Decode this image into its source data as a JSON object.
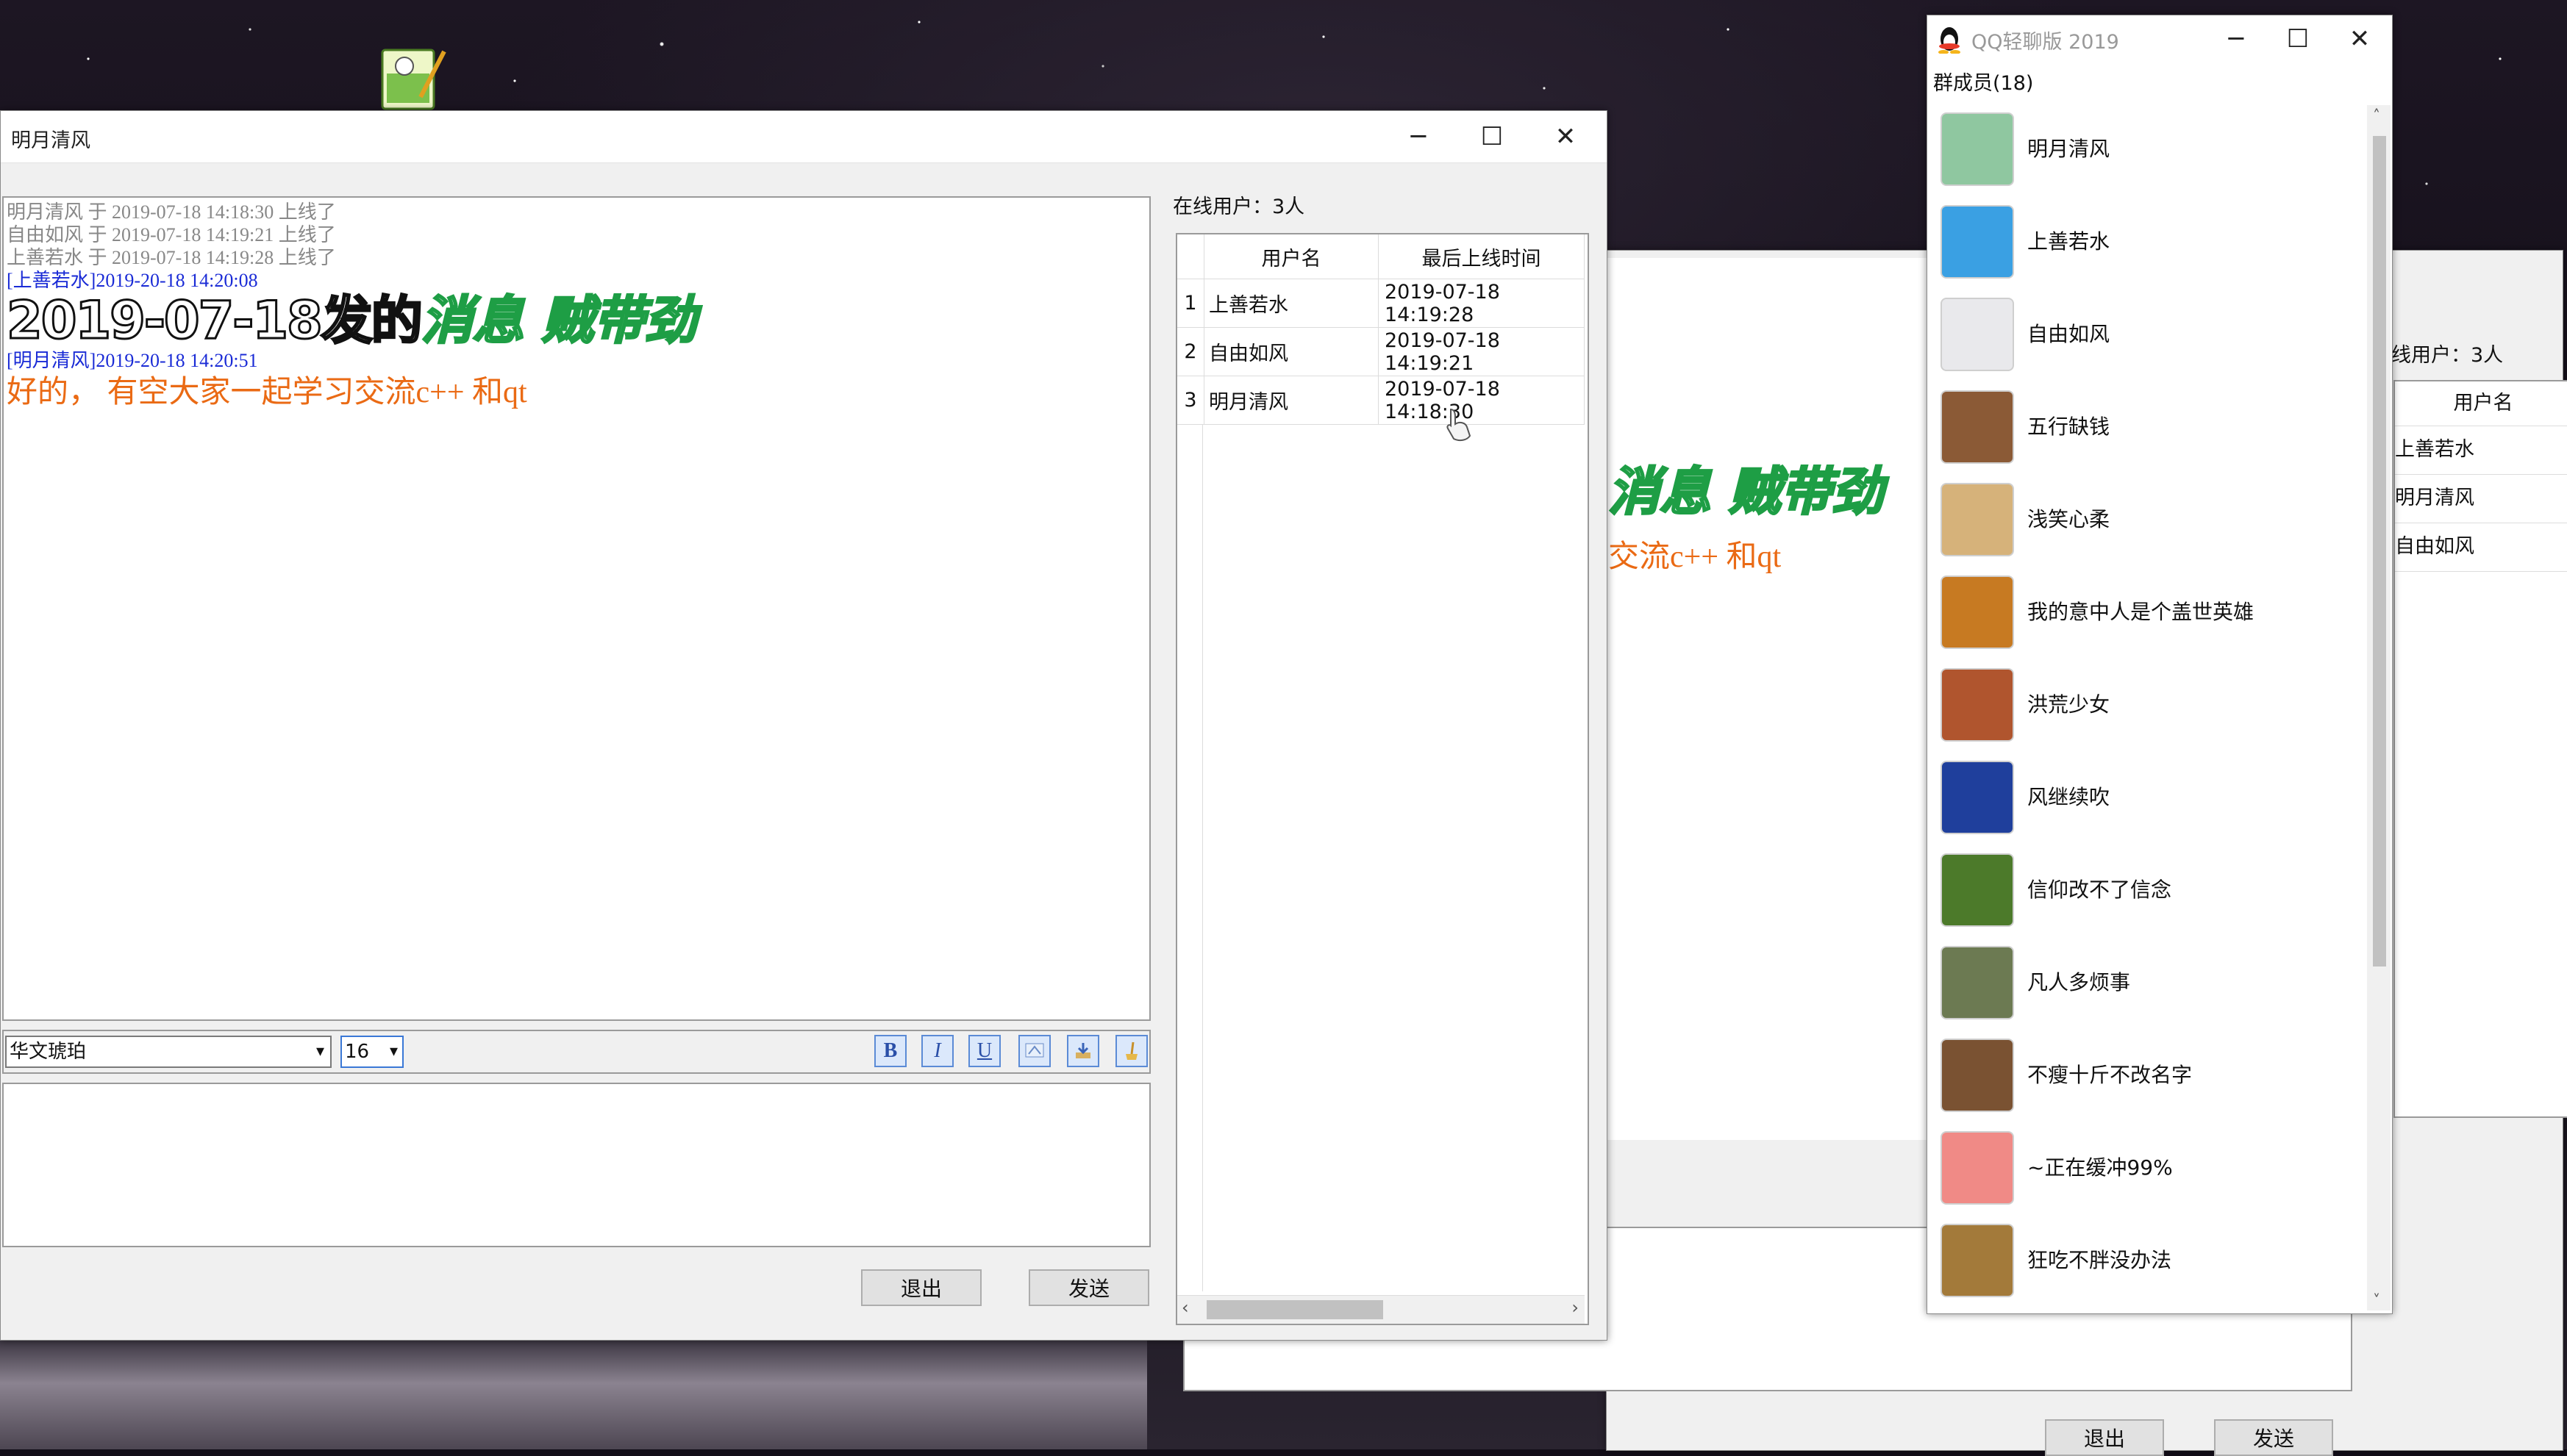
{
  "chat_window": {
    "title": "明月清风",
    "log": {
      "system_lines": [
        "明月清风 于 2019-07-18 14:18:30 上线了",
        "自由如风 于 2019-07-18 14:19:21 上线了",
        "上善若水 于 2019-07-18 14:19:28 上线了"
      ],
      "msg1_meta": "[上善若水]2019-20-18 14:20:08",
      "msg1_text_a": "2019-07-18发的",
      "msg1_text_b": "消息  贼带劲",
      "msg2_meta": "[明月清风]2019-20-18 14:20:51",
      "msg2_text": "好的， 有空大家一起学习交流c++  和qt"
    },
    "font_combo": "华文琥珀",
    "size_combo": "16",
    "format_buttons": {
      "bold": "B",
      "italic": "I",
      "underline": "U"
    },
    "quit_button": "退出",
    "send_button": "发送",
    "online_label": "在线用户：3人",
    "online_table": {
      "headers": [
        "用户名",
        "最后上线时间"
      ],
      "rows": [
        {
          "index": "1",
          "name": "上善若水",
          "time": "2019-07-18 14:19:28"
        },
        {
          "index": "2",
          "name": "自由如风",
          "time": "2019-07-18 14:19:21"
        },
        {
          "index": "3",
          "name": "明月清风",
          "time": "2019-07-18 14:18:30"
        }
      ]
    }
  },
  "back_window": {
    "text_a": "消息  贼带劲",
    "text_b": "交流c++  和qt",
    "online_label": "在线用户：3人",
    "header": "用户名",
    "rows": [
      "上善若水",
      "明月清风",
      "自由如风"
    ],
    "quit_button": "退出",
    "send_button": "发送"
  },
  "members_window": {
    "title": "QQ轻聊版 2019",
    "group_label": "群成员(18)",
    "members": [
      {
        "name": "明月清风",
        "color": "#8fc7a0"
      },
      {
        "name": "上善若水",
        "color": "#3aa0e3"
      },
      {
        "name": "自由如风",
        "color": "#e9e9ec"
      },
      {
        "name": "五行缺钱",
        "color": "#8b5a36"
      },
      {
        "name": "浅笑心柔",
        "color": "#d6b27a"
      },
      {
        "name": "我的意中人是个盖世英雄",
        "color": "#c77a22"
      },
      {
        "name": "洪荒少女",
        "color": "#b0552e"
      },
      {
        "name": "风继续吹",
        "color": "#1f3f9c"
      },
      {
        "name": "信仰改不了信念",
        "color": "#4c7a2a"
      },
      {
        "name": "凡人多烦事",
        "color": "#6c7a52"
      },
      {
        "name": "不瘦十斤不改名字",
        "color": "#7a5232"
      },
      {
        "name": "~正在缓冲99%",
        "color": "#f08a86"
      },
      {
        "name": "狂吃不胖没办法",
        "color": "#a37a3a"
      }
    ]
  },
  "controls": {
    "minimize": "─",
    "maximize": "☐",
    "close": "✕"
  }
}
